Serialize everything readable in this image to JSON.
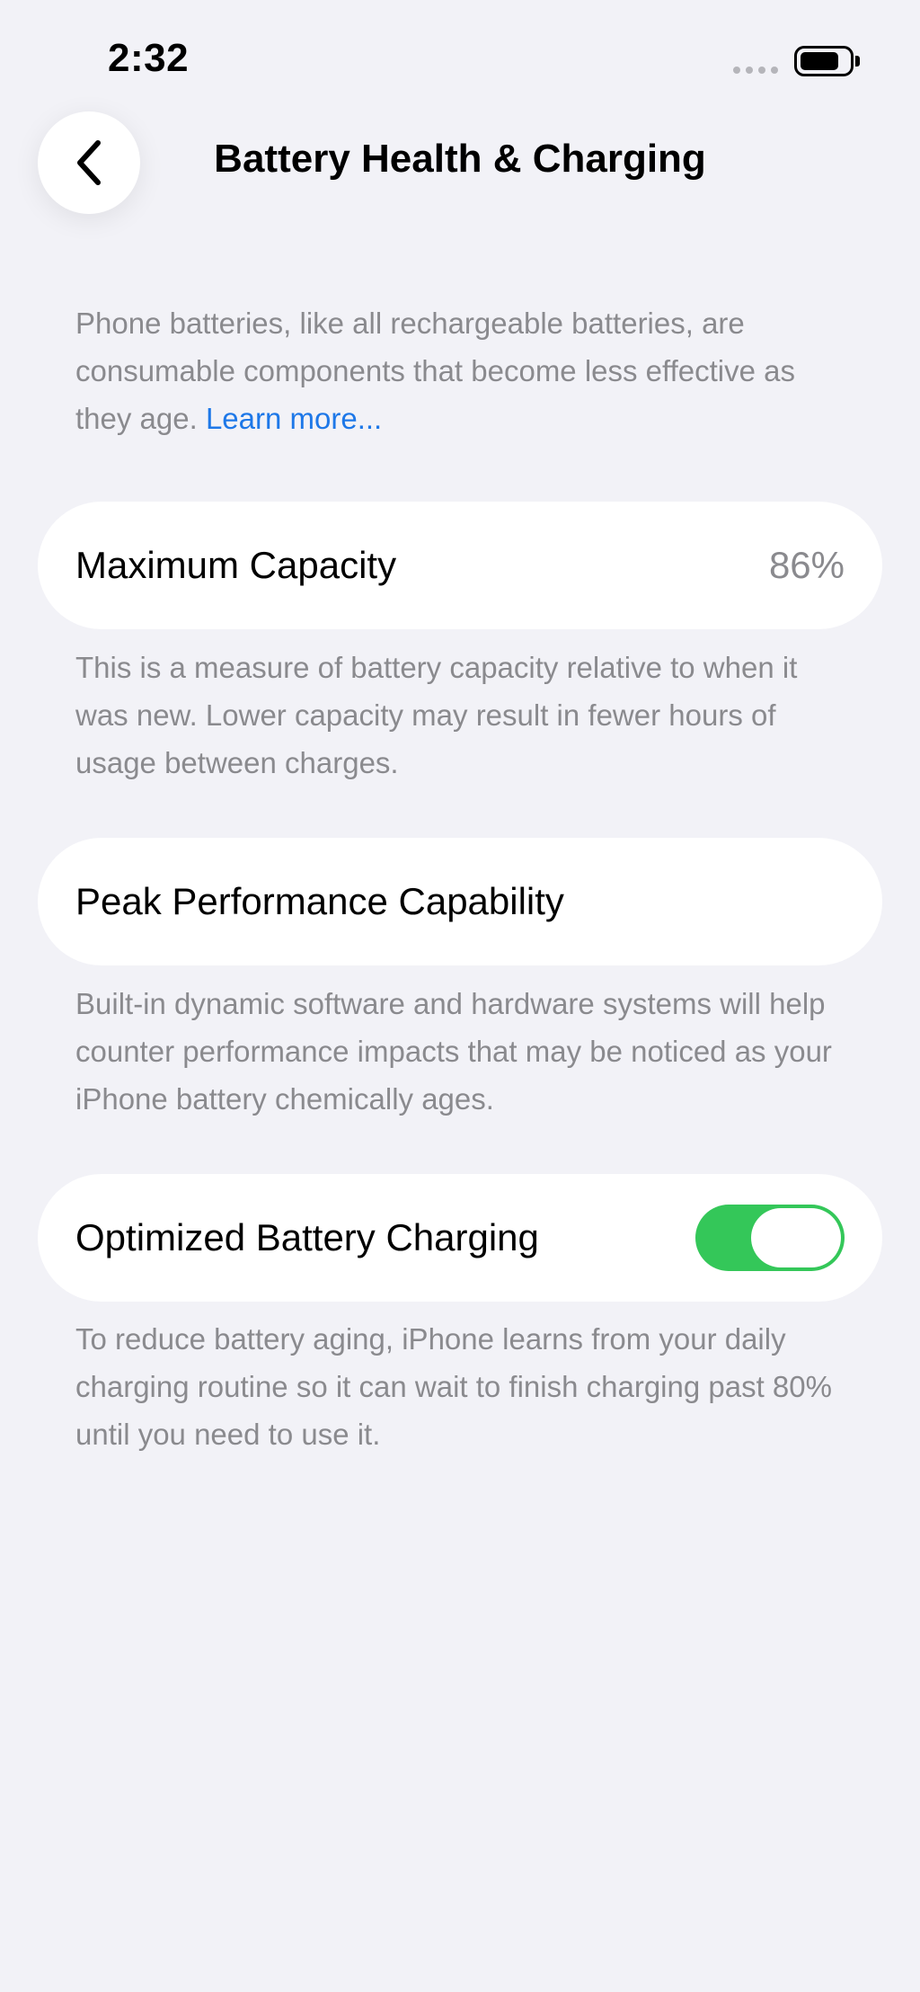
{
  "status_bar": {
    "time": "2:32",
    "battery_level": 0.8
  },
  "nav": {
    "back_icon": "chevron-left-icon",
    "title": "Battery Health & Charging"
  },
  "intro": {
    "text": "Phone batteries, like all rechargeable batteries, are consumable components that become less effective as they age.",
    "link_label": "Learn more..."
  },
  "maximum_capacity": {
    "label": "Maximum Capacity",
    "value": "86%",
    "description": "This is a measure of battery capacity relative to when it was new. Lower capacity may result in fewer hours of usage between charges."
  },
  "peak_performance": {
    "label": "Peak Performance Capability",
    "description": "Built-in dynamic software and hardware systems will help counter performance impacts that may be noticed as your iPhone battery chemically ages."
  },
  "optimized_charging": {
    "label": "Optimized Battery Charging",
    "enabled": true,
    "description": "To reduce battery aging, iPhone learns from your daily charging routine so it can wait to finish charging past 80% until you need to use it."
  },
  "colors": {
    "background": "#F2F2F7",
    "secondary_text": "#8A8A8E",
    "link": "#1E78E8",
    "toggle_on": "#34C759"
  }
}
